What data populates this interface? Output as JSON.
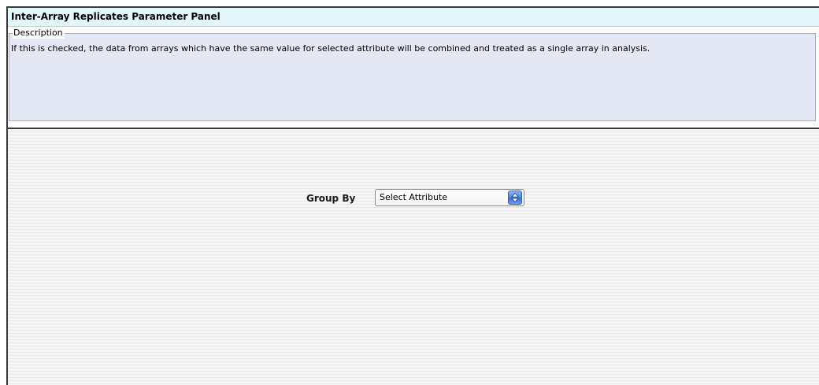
{
  "panel": {
    "title": "Inter-Array Replicates Parameter Panel"
  },
  "description": {
    "legend": "Description",
    "text": "If this is checked, the data from arrays which have the same value for selected attribute will be combined and treated as a single array in analysis."
  },
  "group_by": {
    "label": "Group By",
    "selected": "Select Attribute",
    "arrow_icon": "up-down-arrows-icon"
  },
  "colors": {
    "title_bar_bg": "#e3f7fb",
    "description_bg": "#e4e8f4",
    "select_arrow_accent": "#4e82de"
  }
}
